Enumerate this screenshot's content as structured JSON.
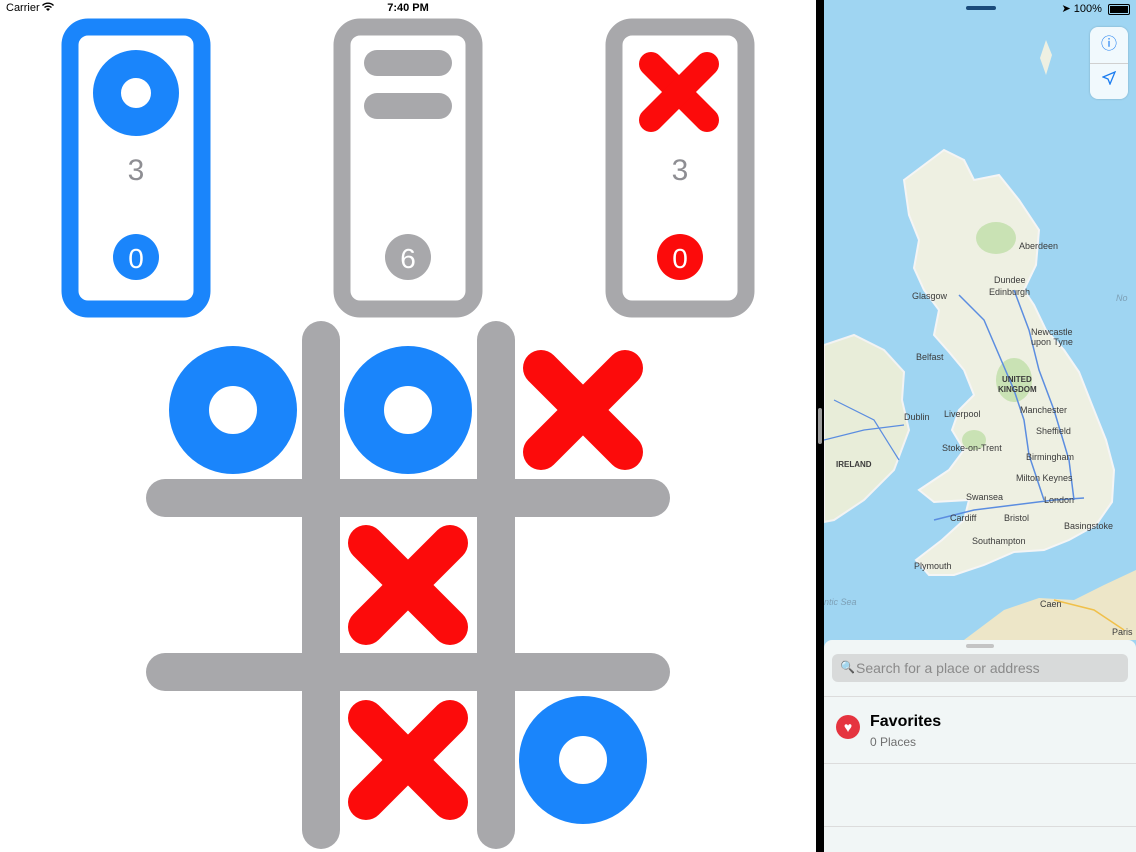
{
  "status": {
    "carrier": "Carrier",
    "time": "7:40 PM",
    "battery": "100%"
  },
  "game": {
    "player_o": {
      "score": "3",
      "count": "0"
    },
    "draw": {
      "count": "6"
    },
    "player_x": {
      "score": "3",
      "count": "0"
    },
    "board": [
      "O",
      "O",
      "X",
      "",
      "X",
      "",
      "",
      "X",
      "O"
    ],
    "colors": {
      "o": "#1a85fb",
      "x": "#fc0b0b",
      "grid": "#a8a8ab"
    }
  },
  "map": {
    "labels": {
      "aberdeen": "Aberdeen",
      "dundee": "Dundee",
      "glasgow": "Glasgow",
      "edinburgh": "Edinburgh",
      "newcastle1": "Newcastle",
      "newcastle2": "upon Tyne",
      "belfast": "Belfast",
      "uk1": "UNITED",
      "uk2": "KINGDOM",
      "dublin": "Dublin",
      "liverpool": "Liverpool",
      "manchester": "Manchester",
      "sheffield": "Sheffield",
      "stoke": "Stoke-on-Trent",
      "ireland": "IRELAND",
      "birmingham": "Birmingham",
      "miltonkeynes": "Milton Keynes",
      "swansea": "Swansea",
      "london": "London",
      "cardiff": "Cardiff",
      "bristol": "Bristol",
      "basingstoke": "Basingstoke",
      "southampton": "Southampton",
      "plymouth": "Plymouth",
      "atlantic": "ntic Sea",
      "caen": "Caen",
      "paris": "Paris",
      "north": "No"
    },
    "search_placeholder": "Search for a place or address",
    "favorites": {
      "title": "Favorites",
      "subtitle": "0 Places"
    }
  }
}
